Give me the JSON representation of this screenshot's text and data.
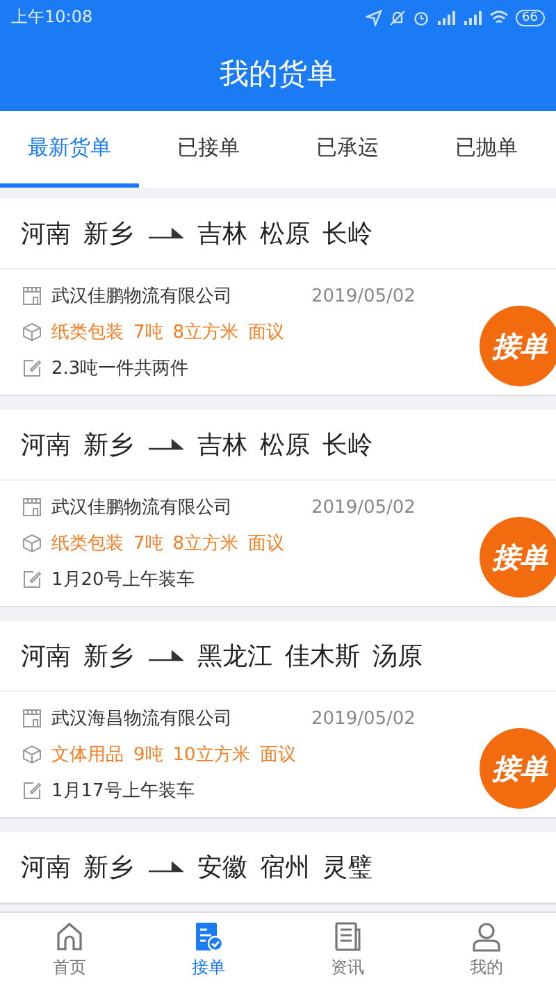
{
  "status_bar": {
    "time": "上午10:08",
    "battery": "66"
  },
  "header": {
    "title": "我的货单"
  },
  "tabs": [
    {
      "label": "最新货单",
      "selected": true
    },
    {
      "label": "已接单",
      "selected": false
    },
    {
      "label": "已承运",
      "selected": false
    },
    {
      "label": "已抛单",
      "selected": false
    }
  ],
  "orders": [
    {
      "origin": [
        "河南",
        "新乡"
      ],
      "destination": [
        "吉林",
        "松原",
        "长岭"
      ],
      "company": "武汉佳鹏物流有限公司",
      "date": "2019/05/02",
      "cargo": [
        "纸类包装",
        "7吨",
        "8立方米",
        "面议"
      ],
      "note": "2.3吨一件共两件",
      "action": "接单"
    },
    {
      "origin": [
        "河南",
        "新乡"
      ],
      "destination": [
        "吉林",
        "松原",
        "长岭"
      ],
      "company": "武汉佳鹏物流有限公司",
      "date": "2019/05/02",
      "cargo": [
        "纸类包装",
        "7吨",
        "8立方米",
        "面议"
      ],
      "note": "1月20号上午装车",
      "action": "接单"
    },
    {
      "origin": [
        "河南",
        "新乡"
      ],
      "destination": [
        "黑龙江",
        "佳木斯",
        "汤原"
      ],
      "company": "武汉海昌物流有限公司",
      "date": "2019/05/02",
      "cargo": [
        "文体用品",
        "9吨",
        "10立方米",
        "面议"
      ],
      "note": "1月17号上午装车",
      "action": "接单"
    },
    {
      "origin": [
        "河南",
        "新乡"
      ],
      "destination": [
        "安徽",
        "宿州",
        "灵璧"
      ]
    }
  ],
  "bottom_nav": [
    {
      "label": "首页",
      "kind": "home",
      "selected": false
    },
    {
      "label": "接单",
      "kind": "orders",
      "selected": true
    },
    {
      "label": "资讯",
      "kind": "news",
      "selected": false
    },
    {
      "label": "我的",
      "kind": "profile",
      "selected": false
    }
  ]
}
